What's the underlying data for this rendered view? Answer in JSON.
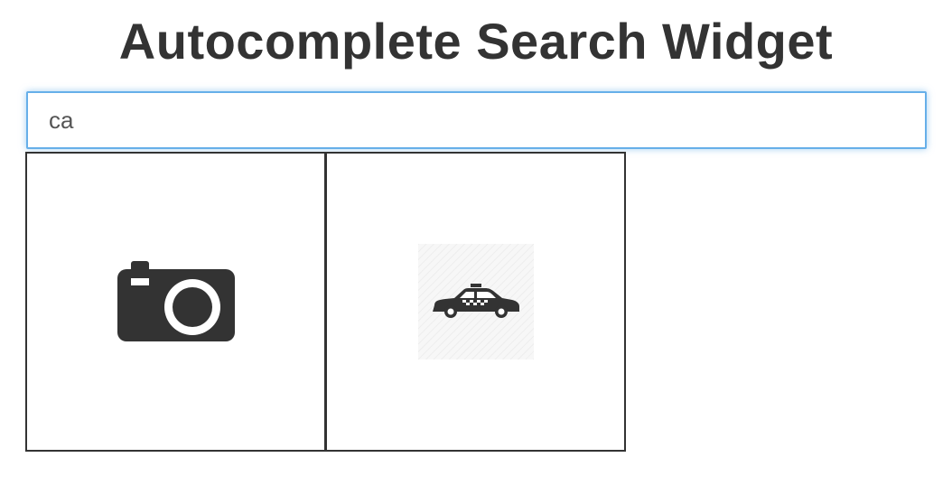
{
  "page": {
    "title": "Autocomplete Search Widget"
  },
  "search": {
    "value": "ca"
  },
  "results": [
    {
      "icon": "camera-icon"
    },
    {
      "icon": "taxi-car-icon"
    }
  ],
  "colors": {
    "text": "#333333",
    "input_focus_border": "#66afe9",
    "tile_border": "#333333",
    "icon": "#333333"
  }
}
